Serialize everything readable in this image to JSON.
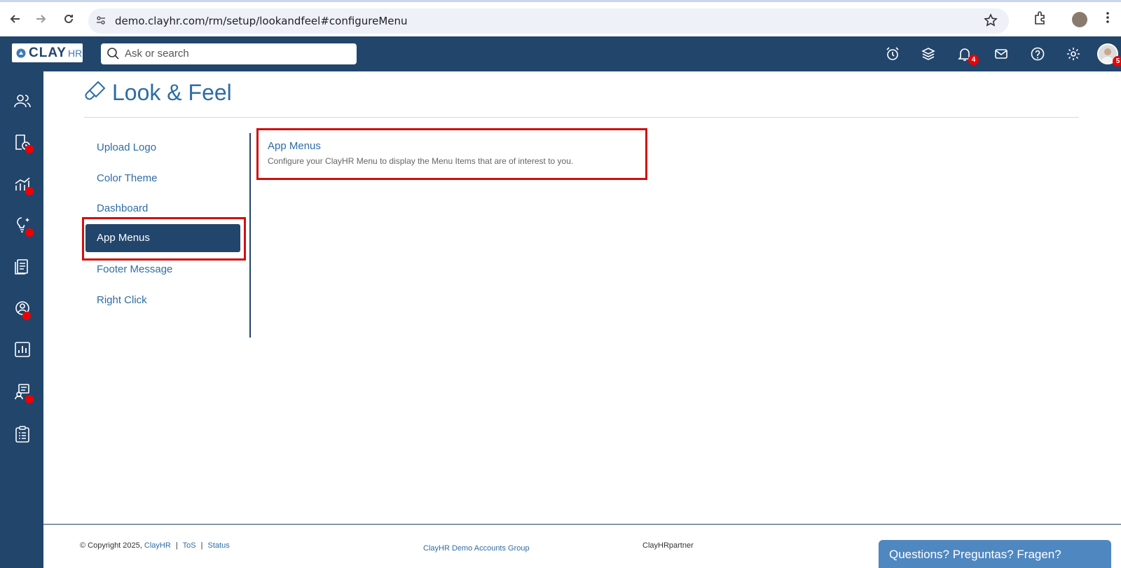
{
  "browser": {
    "url": "demo.clayhr.com/rm/setup/lookandfeel#configureMenu"
  },
  "header": {
    "logo_main": "CLAY",
    "logo_suffix": "HR",
    "search_placeholder": "Ask or search",
    "notification_count": "4",
    "profile_badge": "5"
  },
  "page": {
    "title": "Look & Feel"
  },
  "menu": {
    "items": [
      "Upload Logo",
      "Color Theme",
      "Dashboard",
      "App Menus",
      "Footer Message",
      "Right Click"
    ],
    "active_label": "App Menus"
  },
  "content": {
    "card_title": "App Menus",
    "card_description": "Configure your ClayHR Menu to display the Menu Items that are of interest to you."
  },
  "footer": {
    "copyright": "© Copyright 2025,",
    "brand_link": "ClayHR",
    "tos": "ToS",
    "status": "Status",
    "group": "ClayHR Demo Accounts Group",
    "partner": "ClayHRpartner",
    "chat": "Questions? Preguntas? Fragen?"
  },
  "colors": {
    "brand_dark": "#22456b",
    "link": "#2e6da4",
    "highlight": "#d01010",
    "chat": "#4f87c0"
  }
}
